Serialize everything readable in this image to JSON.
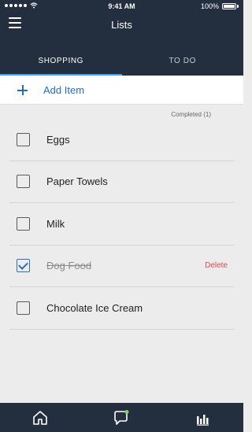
{
  "status_bar": {
    "time": "9:41 AM",
    "battery": "100%"
  },
  "header": {
    "title": "Lists"
  },
  "tabs": [
    {
      "label": "SHOPPING",
      "active": true
    },
    {
      "label": "TO DO",
      "active": false
    }
  ],
  "add_item": {
    "label": "Add Item"
  },
  "completed_label": "Completed (1)",
  "items": [
    {
      "label": "Eggs",
      "checked": false
    },
    {
      "label": "Paper Towels",
      "checked": false
    },
    {
      "label": "Milk",
      "checked": false
    },
    {
      "label": "Dog Food",
      "checked": true,
      "action": "Delete"
    },
    {
      "label": "Chocolate Ice Cream",
      "checked": false
    }
  ],
  "bottom_nav": {
    "icons": [
      "home-icon",
      "chat-icon",
      "bars-icon"
    ],
    "accent": "#7dd35e"
  },
  "colors": {
    "header_bg": "#232f3e",
    "accent_blue": "#1f6fb8",
    "delete_red": "#e2474a"
  }
}
